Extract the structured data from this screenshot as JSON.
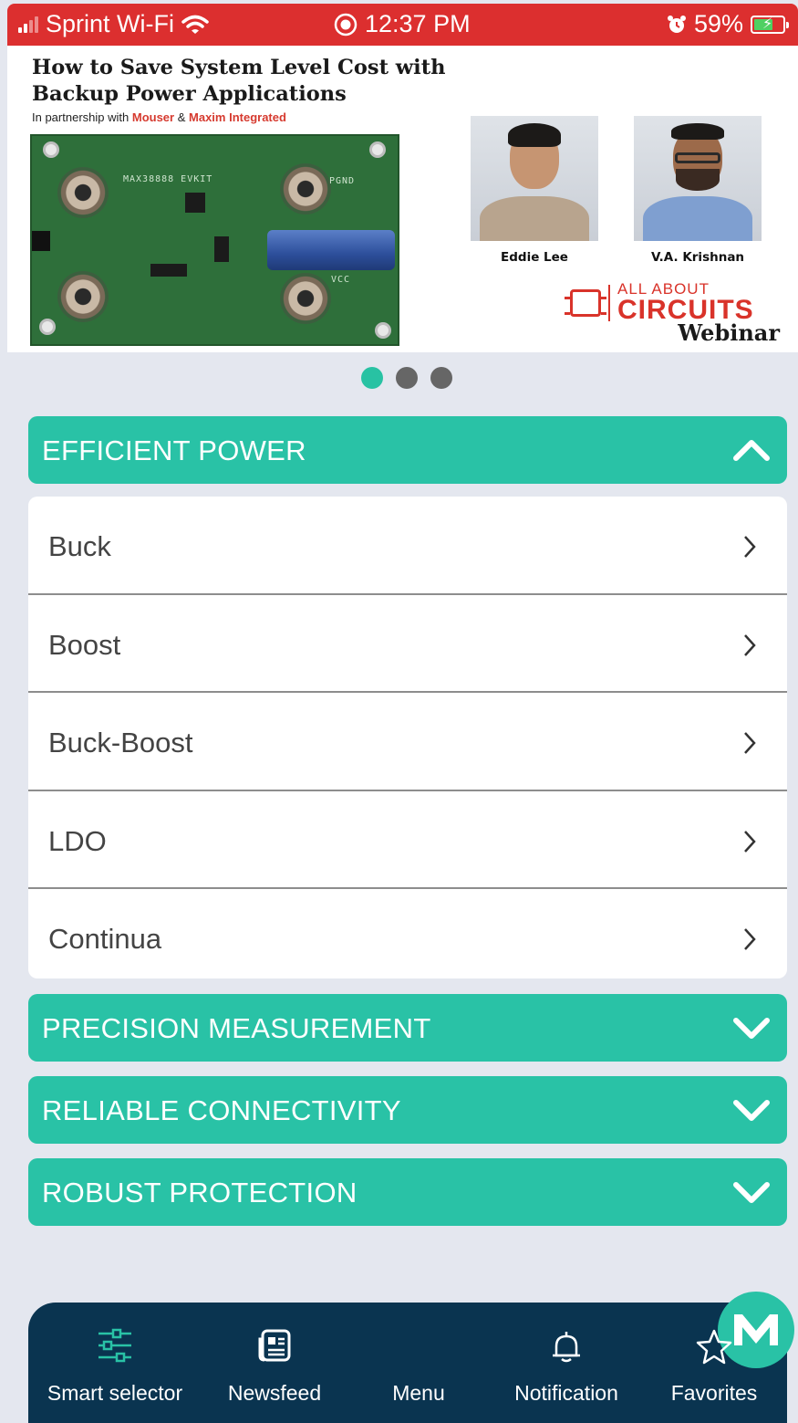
{
  "status_bar": {
    "carrier": "Sprint Wi-Fi",
    "time": "12:37 PM",
    "battery": "59%",
    "battery_level": 0.59
  },
  "banner": {
    "title": "How to Save System Level Cost with Backup Power Applications",
    "partner_prefix": "In partnership with",
    "partner_one": "Mouser",
    "partner_and": "&",
    "partner_two": "Maxim Integrated",
    "presenters": [
      {
        "name": "Eddie Lee"
      },
      {
        "name": "V.A. Krishnan"
      }
    ],
    "logo_small": "ALL ABOUT",
    "logo_big": "CIRCUITS",
    "logo_sub": "Webinar",
    "board_labels": [
      "MAX38888 EVKIT",
      "PGND",
      "VCC"
    ],
    "carousel_pages": 3,
    "carousel_active": 1
  },
  "sections": [
    {
      "title": "EFFICIENT POWER",
      "expanded": true,
      "items": [
        "Buck",
        "Boost",
        "Buck-Boost",
        "LDO",
        "Continua"
      ]
    },
    {
      "title": "PRECISION MEASUREMENT",
      "expanded": false
    },
    {
      "title": "RELIABLE CONNECTIVITY",
      "expanded": false
    },
    {
      "title": "ROBUST PROTECTION",
      "expanded": false
    }
  ],
  "bottom_nav": {
    "items": [
      {
        "label": "Smart selector",
        "icon": "sliders-icon"
      },
      {
        "label": "Newsfeed",
        "icon": "newspaper-icon"
      },
      {
        "label": "Menu",
        "icon": "maxim-logo-icon"
      },
      {
        "label": "Notification",
        "icon": "bell-icon"
      },
      {
        "label": "Favorites",
        "icon": "star-icon"
      }
    ]
  },
  "colors": {
    "status_bar": "#dc2f2f",
    "accent": "#29c2a6",
    "nav_bg": "#0a3450",
    "page_bg": "#e4e7ef"
  }
}
